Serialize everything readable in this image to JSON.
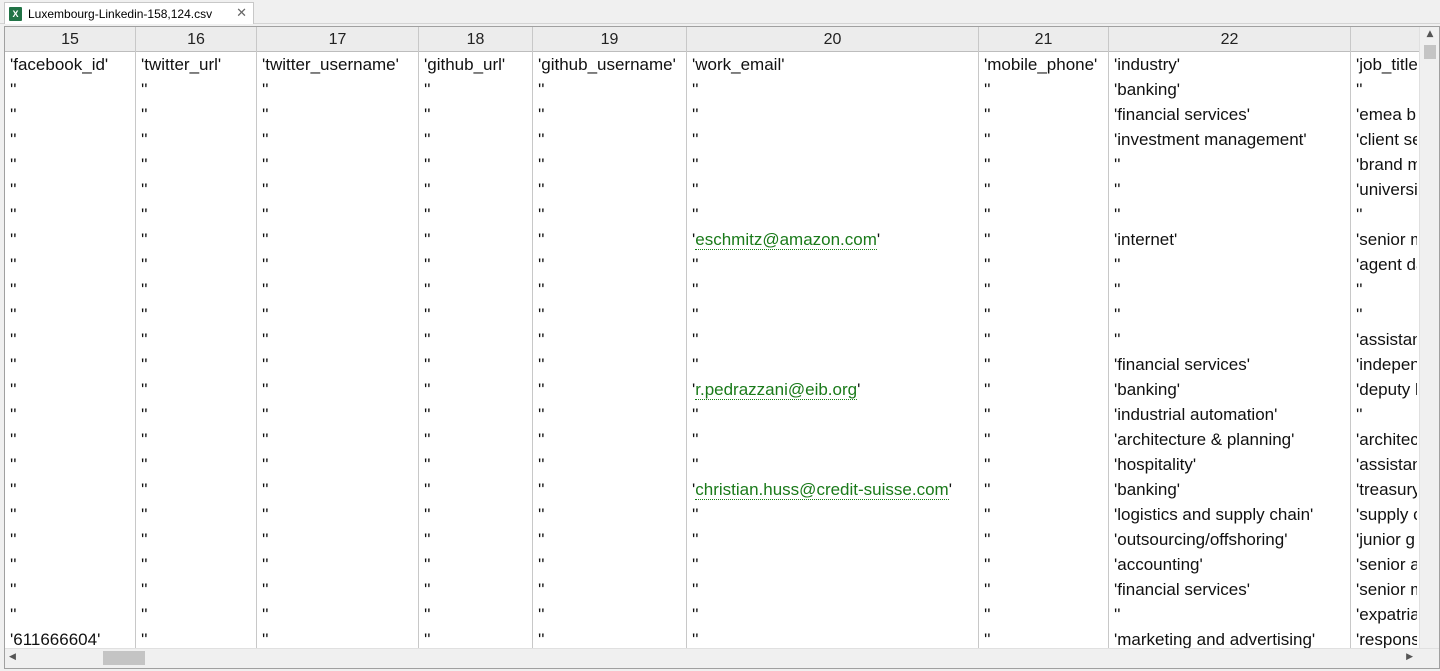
{
  "tab": {
    "title": "Luxembourg-Linkedin-158,124.csv",
    "icon_label": "X",
    "close_symbol": "✕"
  },
  "columns": [
    "15",
    "16",
    "17",
    "18",
    "19",
    "20",
    "21",
    "22",
    ""
  ],
  "rows": [
    [
      "'facebook_id'",
      "'twitter_url'",
      "'twitter_username'",
      "'github_url'",
      "'github_username'",
      "'work_email'",
      "'mobile_phone'",
      "'industry'",
      "'job_title"
    ],
    [
      "''",
      "''",
      "''",
      "''",
      "''",
      "''",
      "''",
      "'banking'",
      "''"
    ],
    [
      "''",
      "''",
      "''",
      "''",
      "''",
      "''",
      "''",
      "'financial services'",
      "'emea bu"
    ],
    [
      "''",
      "''",
      "''",
      "''",
      "''",
      "''",
      "''",
      "'investment management'",
      "'client se"
    ],
    [
      "''",
      "''",
      "''",
      "''",
      "''",
      "''",
      "''",
      "''",
      "'brand m"
    ],
    [
      "''",
      "''",
      "''",
      "''",
      "''",
      "''",
      "''",
      "''",
      "'universit"
    ],
    [
      "''",
      "''",
      "''",
      "''",
      "''",
      "''",
      "''",
      "''",
      "''"
    ],
    [
      "''",
      "''",
      "''",
      "''",
      "''",
      "'eschmitz@amazon.com'",
      "''",
      "'internet'",
      "'senior m"
    ],
    [
      "''",
      "''",
      "''",
      "''",
      "''",
      "''",
      "''",
      "''",
      "'agent da"
    ],
    [
      "''",
      "''",
      "''",
      "''",
      "''",
      "''",
      "''",
      "''",
      "''"
    ],
    [
      "''",
      "''",
      "''",
      "''",
      "''",
      "''",
      "''",
      "''",
      "''"
    ],
    [
      "''",
      "''",
      "''",
      "''",
      "''",
      "''",
      "''",
      "''",
      "'assistan"
    ],
    [
      "''",
      "''",
      "''",
      "''",
      "''",
      "''",
      "''",
      "'financial services'",
      "'indepen"
    ],
    [
      "''",
      "''",
      "''",
      "''",
      "''",
      "'r.pedrazzani@eib.org'",
      "''",
      "'banking'",
      "'deputy h"
    ],
    [
      "''",
      "''",
      "''",
      "''",
      "''",
      "''",
      "''",
      "'industrial automation'",
      "''"
    ],
    [
      "''",
      "''",
      "''",
      "''",
      "''",
      "''",
      "''",
      "'architecture & planning'",
      "'architec"
    ],
    [
      "''",
      "''",
      "''",
      "''",
      "''",
      "''",
      "''",
      "'hospitality'",
      "'assistan"
    ],
    [
      "''",
      "''",
      "''",
      "''",
      "''",
      "'christian.huss@credit-suisse.com'",
      "''",
      "'banking'",
      "'treasury"
    ],
    [
      "''",
      "''",
      "''",
      "''",
      "''",
      "''",
      "''",
      "'logistics and supply chain'",
      "'supply c"
    ],
    [
      "''",
      "''",
      "''",
      "''",
      "''",
      "''",
      "''",
      "'outsourcing/offshoring'",
      "'junior g"
    ],
    [
      "''",
      "''",
      "''",
      "''",
      "''",
      "''",
      "''",
      "'accounting'",
      "'senior a"
    ],
    [
      "''",
      "''",
      "''",
      "''",
      "''",
      "''",
      "''",
      "'financial services'",
      "'senior m"
    ],
    [
      "''",
      "''",
      "''",
      "''",
      "''",
      "''",
      "''",
      "''",
      "'expatria"
    ],
    [
      "'611666604'",
      "''",
      "''",
      "''",
      "''",
      "''",
      "''",
      "'marketing and advertising'",
      "'respons"
    ]
  ],
  "colors": {
    "email": "#1a7a1a",
    "excel_icon": "#217346"
  },
  "scrollbars": {
    "up": "▲",
    "left": "◀",
    "right": "▶"
  }
}
